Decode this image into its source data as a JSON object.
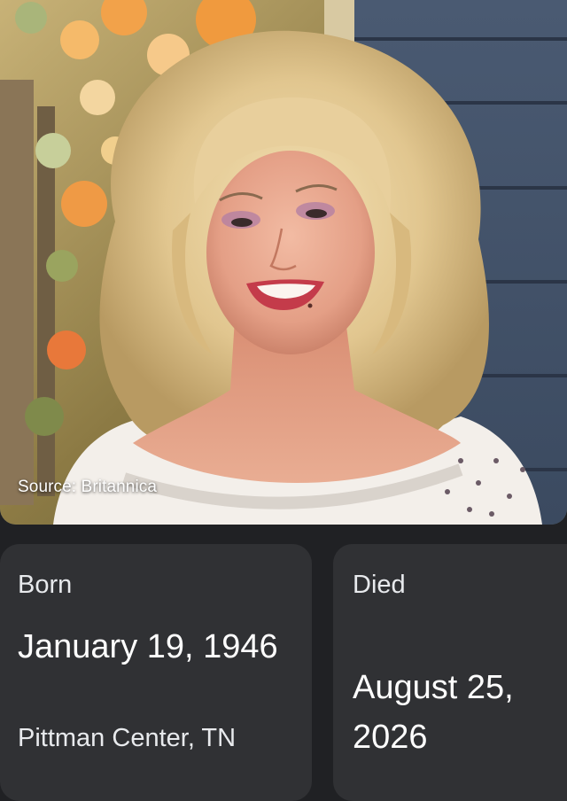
{
  "photo": {
    "source_caption": "Source: Britannica"
  },
  "born": {
    "label": "Born",
    "date": "January 19, 1946",
    "place": "Pittman Center, TN"
  },
  "died": {
    "label": "Died",
    "date": "August 25, 2026"
  },
  "colors": {
    "background": "#202124",
    "card": "#303134",
    "text": "#ffffff"
  }
}
